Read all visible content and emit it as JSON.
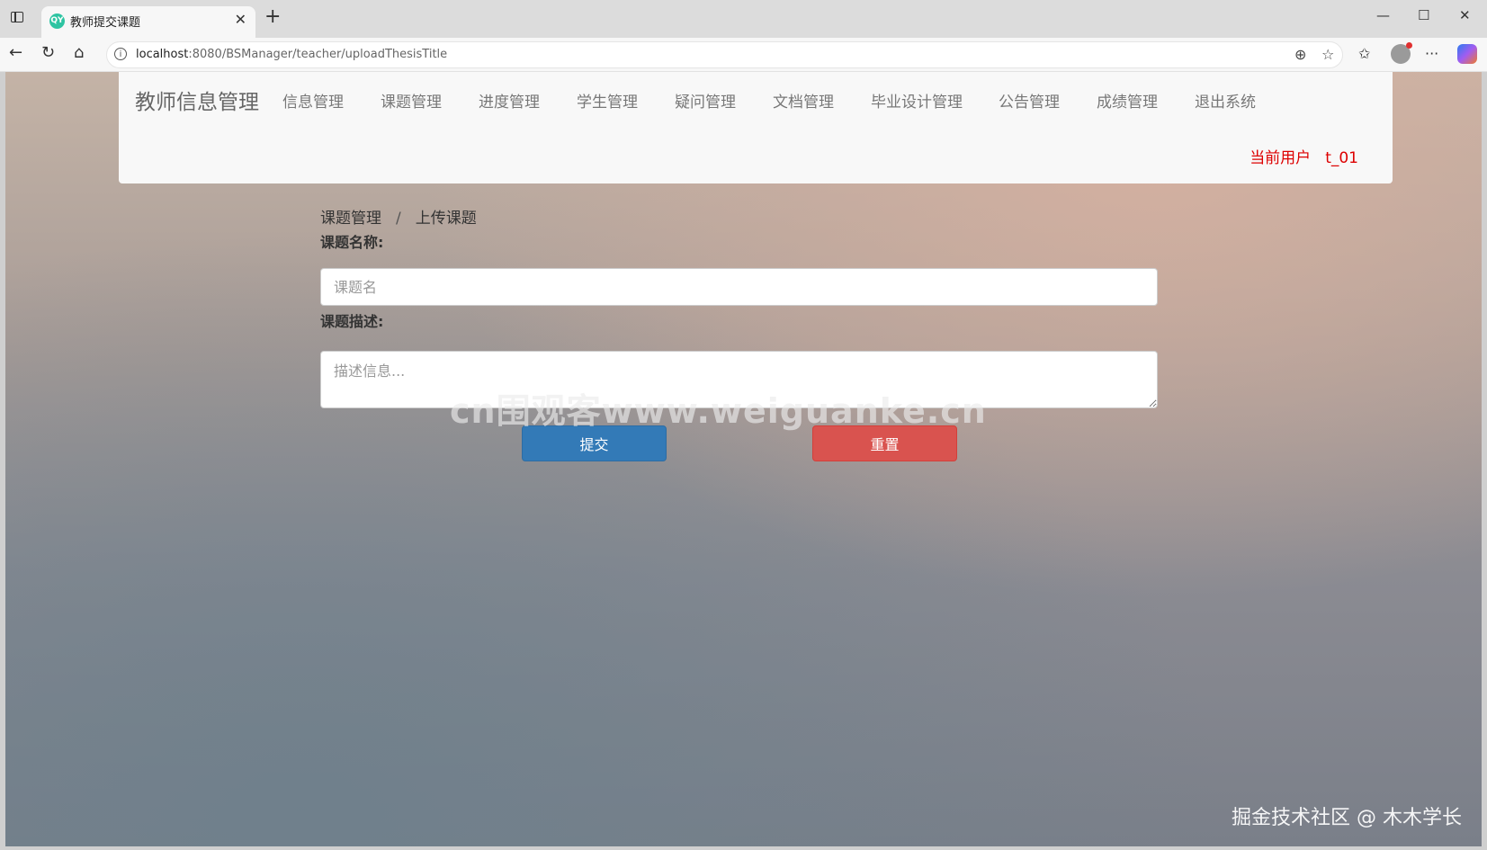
{
  "browser": {
    "tab_title": "教师提交课题",
    "tab_favicon_text": "QY",
    "address_host": "localhost",
    "address_rest": ":8080/BSManager/teacher/uploadThesisTitle",
    "icons": [
      "tab-strip-icon",
      "close-icon",
      "new-tab-icon",
      "minimize-icon",
      "maximize-icon",
      "window-close-icon",
      "back-icon",
      "reload-icon",
      "home-icon",
      "info-icon",
      "zoom-icon",
      "star-icon",
      "favorites-icon",
      "profile-avatar",
      "more-icon",
      "copilot-icon"
    ]
  },
  "navbar": {
    "brand": "教师信息管理",
    "links": [
      "信息管理",
      "课题管理",
      "进度管理",
      "学生管理",
      "疑问管理",
      "文档管理",
      "毕业设计管理",
      "公告管理",
      "成绩管理",
      "退出系统"
    ],
    "current_user_label": "当前用户",
    "current_user_value": "t_01"
  },
  "breadcrumb": {
    "parent": "课题管理",
    "separator": "/",
    "current": "上传课题"
  },
  "form": {
    "title_label": "课题名称:",
    "title_placeholder": "课题名",
    "title_value": "",
    "desc_label": "课题描述:",
    "desc_placeholder": "描述信息...",
    "desc_value": "",
    "submit_label": "提交",
    "reset_label": "重置"
  },
  "watermarks": {
    "center": "cn围观客www.weiguanke.cn",
    "corner": "掘金技术社区 @ 木木学长"
  },
  "colors": {
    "submit": "#337ab7",
    "reset": "#d9534f",
    "current_user": "#dd0000"
  }
}
